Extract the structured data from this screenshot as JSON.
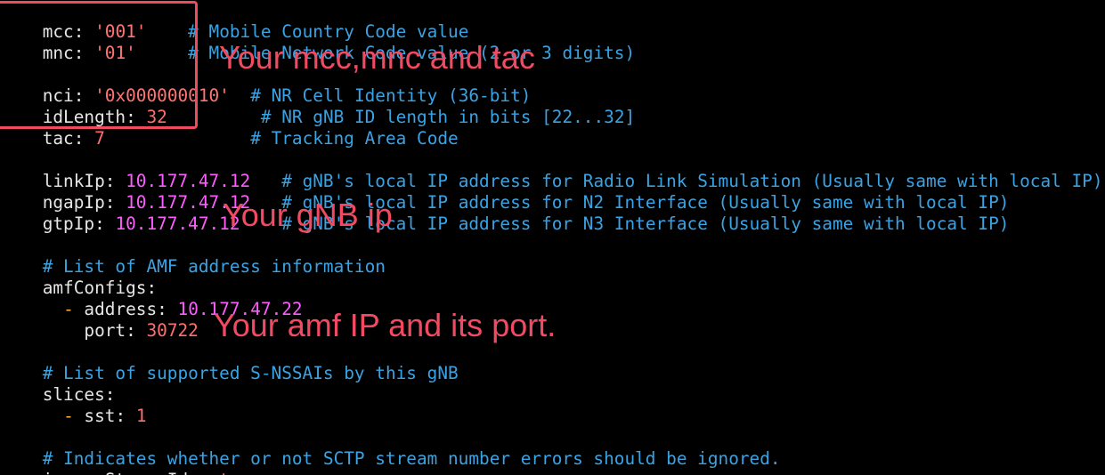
{
  "editor": {
    "lines": [
      {
        "key": "mcc",
        "value": "'001'",
        "vtype": "s",
        "pad": "    ",
        "comment": "# Mobile Country Code value"
      },
      {
        "key": "mnc",
        "value": "'01'",
        "vtype": "s",
        "pad": "     ",
        "comment": "# Mobile Network Code value (2 or 3 digits)"
      },
      {
        "key": "nci",
        "value": "'0x000000010'",
        "vtype": "s",
        "pad": "  ",
        "comment": "# NR Cell Identity (36-bit)"
      },
      {
        "key": "idLength",
        "value": "32",
        "vtype": "n",
        "pad": "         ",
        "comment": "# NR gNB ID length in bits [22...32]"
      },
      {
        "key": "tac",
        "value": "7",
        "vtype": "n",
        "pad": "              ",
        "comment": "# Tracking Area Code"
      },
      {
        "key": "linkIp",
        "value": "10.177.47.12",
        "vtype": "ip",
        "pad": "   ",
        "comment": "# gNB's local IP address for Radio Link Simulation (Usually same with local IP)"
      },
      {
        "key": "ngapIp",
        "value": "10.177.47.12",
        "vtype": "ip",
        "pad": "   ",
        "comment": "# gNB's local IP address for N2 Interface (Usually same with local IP)"
      },
      {
        "key": "gtpIp",
        "value": "10.177.47.12",
        "vtype": "ip",
        "pad": "    ",
        "comment": "# gNB's local IP address for N3 Interface (Usually same with local IP)"
      },
      {
        "comment": "# List of AMF address information"
      },
      {
        "key": "amfConfigs"
      },
      {
        "key": "address",
        "value": "10.177.47.22",
        "vtype": "ip",
        "dash": true
      },
      {
        "key": "port",
        "value": "30722",
        "vtype": "n",
        "indent": "    "
      },
      {
        "comment": "# List of supported S-NSSAIs by this gNB"
      },
      {
        "key": "slices"
      },
      {
        "key": "sst",
        "value": "1",
        "vtype": "n",
        "dash": true
      },
      {
        "comment": "# Indicates whether or not SCTP stream number errors should be ignored."
      },
      {
        "key": "ignoreStreamIds",
        "value": "true",
        "vtype": "b"
      }
    ]
  },
  "annotations": {
    "mcc_mnc_tac": "Your mcc,mnc and tac",
    "gnb_ip": "Your gNB ip",
    "amf_ip_port": "Your amf IP and its port."
  },
  "colors": {
    "background": "#000000",
    "annotation": "#f24a62",
    "comment": "#3aa3e3",
    "ip_value": "#ff5cff",
    "string_value": "#ff7575"
  }
}
